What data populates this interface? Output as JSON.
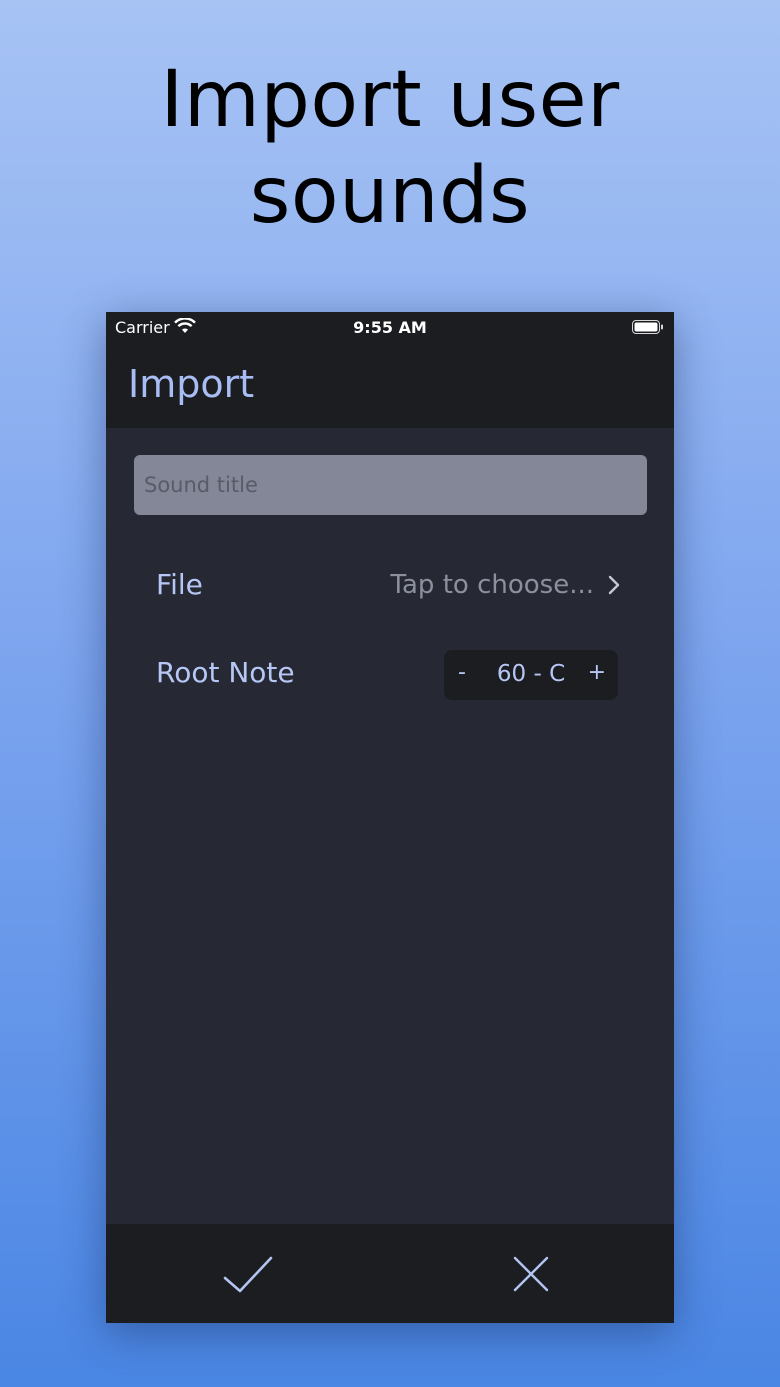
{
  "headline": {
    "line1": "Import user",
    "line2": "sounds"
  },
  "statusbar": {
    "carrier": "Carrier",
    "time": "9:55 AM"
  },
  "navbar": {
    "title": "Import"
  },
  "form": {
    "title_placeholder": "Sound title",
    "title_value": "",
    "file_label": "File",
    "file_value": "Tap to choose...",
    "root_note_label": "Root Note",
    "stepper": {
      "minus": "-",
      "value": "60 - C",
      "plus": "+"
    }
  },
  "bottombar": {
    "confirm_icon": "checkmark-icon",
    "cancel_icon": "close-icon"
  },
  "colors": {
    "accent": "#a9bdf5",
    "background": "#262933",
    "bar": "#1c1d21",
    "input": "#838797"
  }
}
